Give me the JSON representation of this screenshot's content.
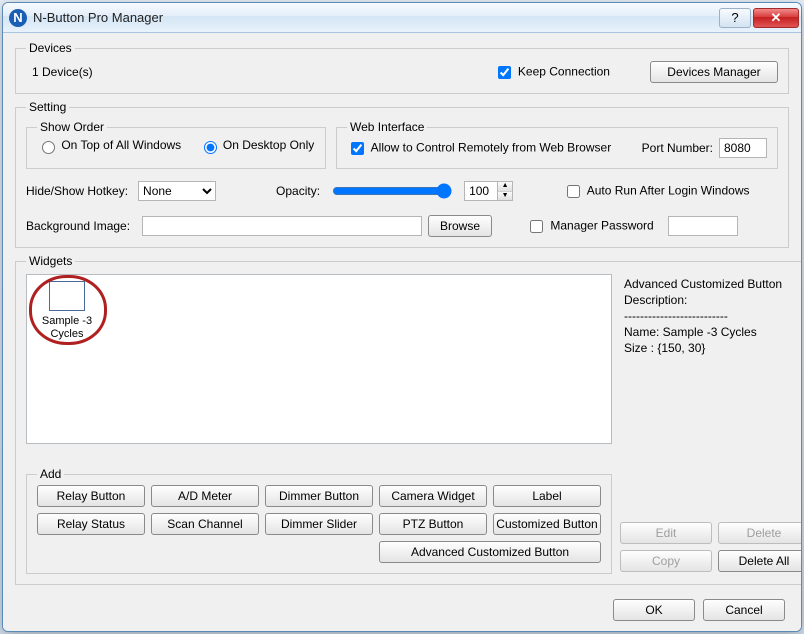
{
  "window": {
    "title": "N-Button Pro Manager",
    "icon_letter": "N"
  },
  "devices": {
    "legend": "Devices",
    "count_text": "1 Device(s)",
    "keep_connection_label": "Keep Connection",
    "keep_connection_checked": true,
    "manager_btn": "Devices Manager"
  },
  "setting": {
    "legend": "Setting",
    "show_order": {
      "legend": "Show Order",
      "opt_top": "On Top of All Windows",
      "opt_desktop": "On Desktop Only",
      "selected": "desktop"
    },
    "web_interface": {
      "legend": "Web Interface",
      "allow_label": "Allow to Control Remotely from Web Browser",
      "allow_checked": true,
      "port_label": "Port Number:",
      "port_value": "8080"
    },
    "hotkey_label": "Hide/Show Hotkey:",
    "hotkey_value": "None",
    "opacity_label": "Opacity:",
    "opacity_value": "100",
    "autorun_label": "Auto Run After Login Windows",
    "autorun_checked": false,
    "bg_label": "Background Image:",
    "bg_value": "",
    "browse_btn": "Browse",
    "mgrpwd_label": "Manager Password",
    "mgrpwd_checked": false,
    "mgrpwd_value": ""
  },
  "widgets": {
    "legend": "Widgets",
    "item_label": "Sample -3 Cycles",
    "desc_heading": "Advanced Customized Button",
    "desc_sub": "Description:",
    "desc_sep": "--------------------------",
    "desc_name": "Name: Sample -3 Cycles",
    "desc_size": "Size : {150, 30}"
  },
  "add": {
    "legend": "Add",
    "buttons": [
      "Relay Button",
      "A/D Meter",
      "Dimmer Button",
      "Camera Widget",
      "Label",
      "Relay Status",
      "Scan Channel",
      "Dimmer Slider",
      "PTZ Button",
      "Customized Button"
    ],
    "advanced": "Advanced Customized Button"
  },
  "side_buttons": {
    "edit": "Edit",
    "delete": "Delete",
    "copy": "Copy",
    "delete_all": "Delete All"
  },
  "footer": {
    "ok": "OK",
    "cancel": "Cancel"
  }
}
